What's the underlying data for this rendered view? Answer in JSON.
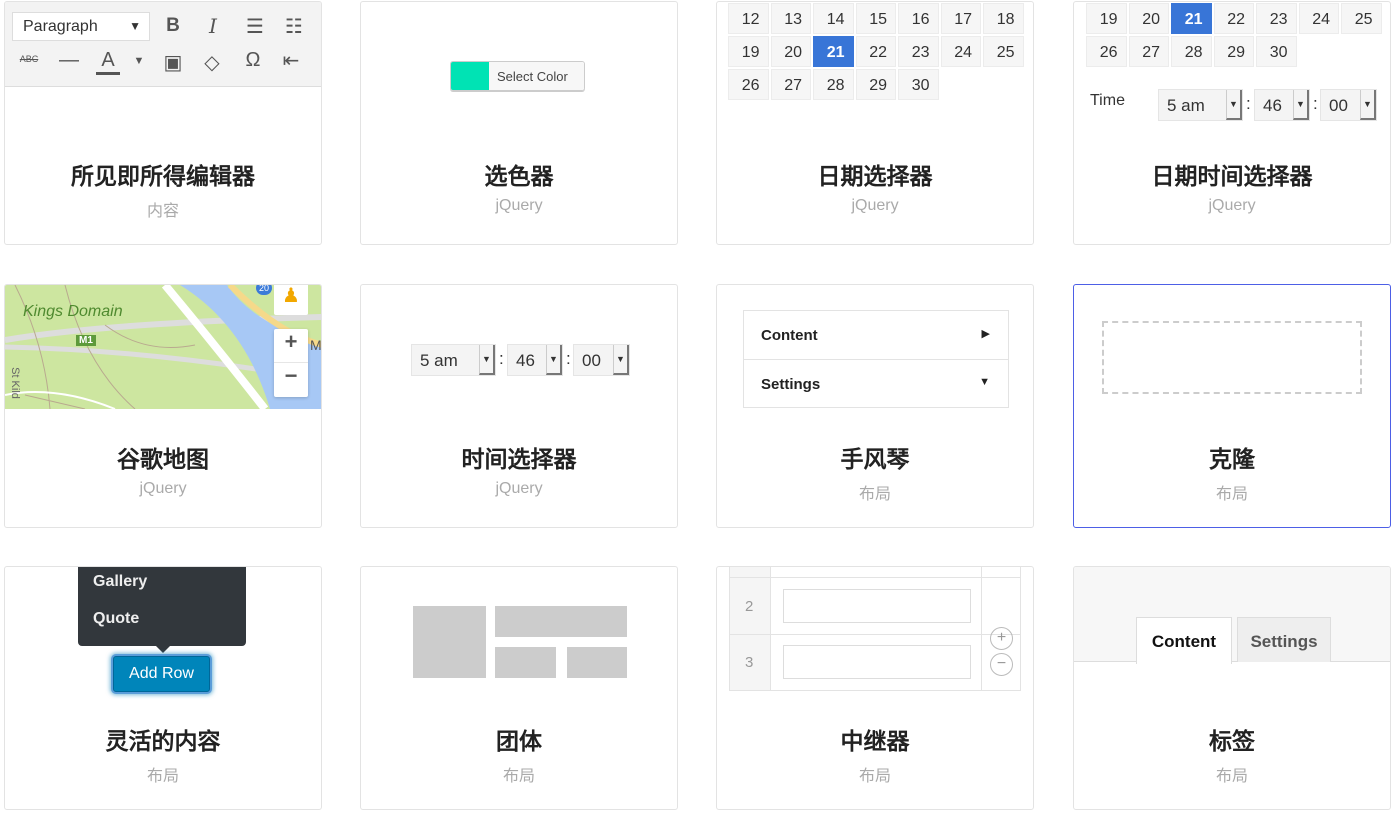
{
  "cards": [
    {
      "title": "所见即所得编辑器",
      "category": "内容",
      "preview": {
        "format_select": "Paragraph",
        "icons": [
          "bold-icon",
          "italic-icon",
          "bullet-list-icon",
          "numbered-list-icon",
          "strikethrough-icon",
          "horizontal-rule-icon",
          "text-color-icon",
          "dropdown-icon",
          "paste-text-icon",
          "eraser-icon",
          "omega-icon",
          "outdent-icon"
        ]
      }
    },
    {
      "title": "选色器",
      "category": "jQuery",
      "preview": {
        "button_label": "Select Color",
        "swatch_color": "#00e3b4"
      }
    },
    {
      "title": "日期选择器",
      "category": "jQuery",
      "preview": {
        "days": [
          "12",
          "13",
          "14",
          "15",
          "16",
          "17",
          "18",
          "19",
          "20",
          "21",
          "22",
          "23",
          "24",
          "25",
          "26",
          "27",
          "28",
          "29",
          "30"
        ],
        "selected": "21"
      }
    },
    {
      "title": "日期时间选择器",
      "category": "jQuery",
      "preview": {
        "days": [
          "19",
          "20",
          "21",
          "22",
          "23",
          "24",
          "25",
          "26",
          "27",
          "28",
          "29",
          "30"
        ],
        "selected": "21",
        "time_label": "Time",
        "hour": "5 am",
        "minute": "46",
        "second": "00"
      }
    },
    {
      "title": "谷歌地图",
      "category": "jQuery",
      "preview": {
        "labels": [
          "Kings Domain",
          "M1",
          "St Kild",
          "20",
          "MI"
        ],
        "zoom_in": "+",
        "zoom_out": "−"
      }
    },
    {
      "title": "时间选择器",
      "category": "jQuery",
      "preview": {
        "hour": "5 am",
        "minute": "46",
        "second": "00"
      }
    },
    {
      "title": "手风琴",
      "category": "布局",
      "preview": {
        "items": [
          "Content",
          "Settings"
        ]
      }
    },
    {
      "title": "克隆",
      "category": "布局",
      "selected": true
    },
    {
      "title": "灵活的内容",
      "category": "布局",
      "preview": {
        "menu": [
          "Gallery",
          "Quote"
        ],
        "button_label": "Add Row"
      }
    },
    {
      "title": "团体",
      "category": "布局"
    },
    {
      "title": "中继器",
      "category": "布局",
      "preview": {
        "rows": [
          "2",
          "3"
        ]
      }
    },
    {
      "title": "标签",
      "category": "布局",
      "preview": {
        "tabs": [
          "Content",
          "Settings"
        ]
      }
    }
  ],
  "colors": {
    "accent": "#3875d7",
    "button": "#0085ba",
    "selected_border": "#4d5fe6"
  }
}
